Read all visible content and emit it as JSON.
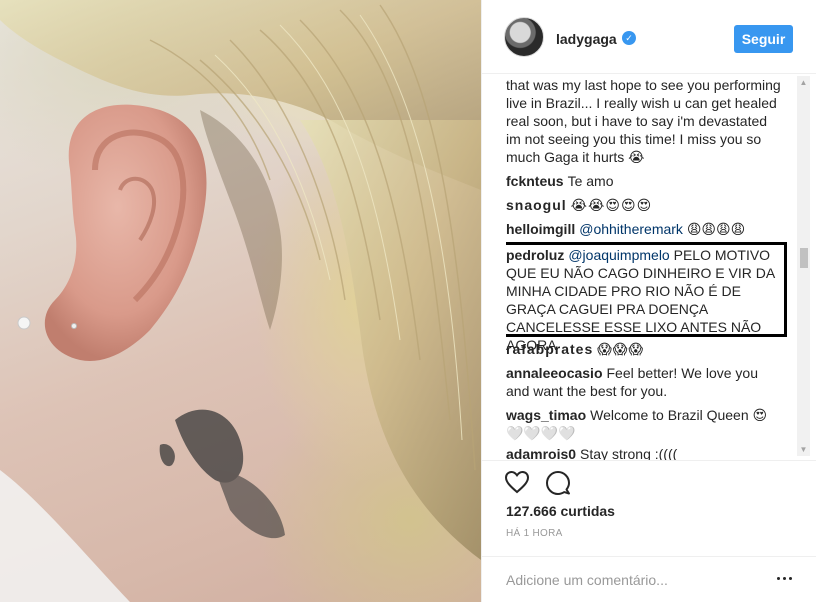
{
  "post": {
    "username": "ladygaga",
    "verified_mark": "✓",
    "follow_label": "Seguir",
    "likes_text": "127.666 curtidas",
    "time_text": "HÁ 1 HORA",
    "comment_placeholder": "Adicione um comentário...",
    "icons": [
      "avatar",
      "verified-icon",
      "heart-icon",
      "comment-icon",
      "more-options-icon"
    ]
  },
  "comments": [
    {
      "user": "",
      "text": "that was my last hope to see you performing live in Brazil... I really wish u can get healed real soon, but i have to say i'm devastated im not seeing you this time! I miss you so much Gaga it hurts 😭"
    },
    {
      "user": "fcknteus",
      "text": "Te amo"
    },
    {
      "user": "snaogul",
      "text": "😭😭😍😍😍"
    },
    {
      "user": "helloimgill",
      "mention": "@ohhitheremark",
      "text": "😩😩😩😩"
    },
    {
      "user": "pedroluz",
      "mention": "@joaquimpmelo",
      "text": "PELO MOTIVO QUE EU NÃO CAGO DINHEIRO E VIR DA MINHA CIDADE PRO RIO NÃO É DE GRAÇA CAGUEI PRA DOENÇA CANCELESSE ESSE LIXO ANTES NÃO AGORA"
    },
    {
      "user": "rafabprates",
      "text": "😱😱😱"
    },
    {
      "user": "annaleeocasio",
      "text": "Feel better! We love you and want the best for you."
    },
    {
      "user": "wags_timao",
      "text": "Welcome to Brazil Queen 😍 🤍🤍🤍🤍"
    },
    {
      "user": "adamrois0",
      "text": "Stay strong :(((("
    }
  ],
  "colors": {
    "accent": "#3897f0",
    "text": "#262626",
    "mention": "#003569",
    "muted": "#999999",
    "divider": "#efefef"
  }
}
